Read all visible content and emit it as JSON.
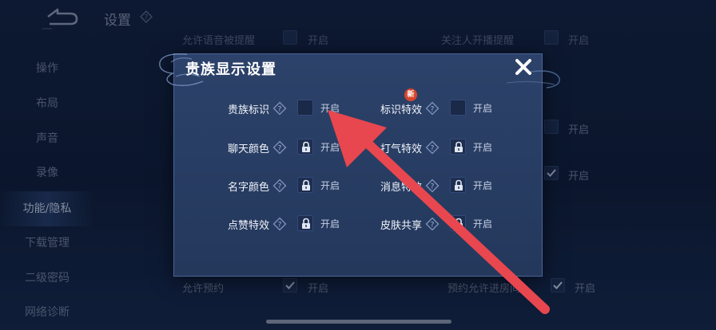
{
  "header": {
    "title": "设置",
    "back_icon": "back-arrow-icon",
    "help_icon": "help-diamond-icon"
  },
  "sidebar": {
    "items": [
      {
        "label": "操作"
      },
      {
        "label": "布局"
      },
      {
        "label": "声音"
      },
      {
        "label": "录像"
      },
      {
        "label": "功能/隐私",
        "active": true
      },
      {
        "label": "下载管理"
      },
      {
        "label": "二级密码"
      },
      {
        "label": "网络诊断"
      }
    ]
  },
  "background": {
    "top_left_label": "允许语音被提醒",
    "top_left_value": "开启",
    "top_right_label": "关注人开播提醒",
    "top_right_value": "开启",
    "mid_right_value_1": "开启",
    "mid_right_value_2": "开启",
    "bottom_left_label": "允许预约",
    "bottom_left_value": "开启",
    "bottom_right_label": "预约允许进房间",
    "bottom_right_value": "开启"
  },
  "dialog": {
    "title": "贵族显示设置",
    "close_icon": "close-x-icon",
    "new_badge": "新",
    "settings": [
      {
        "label": "贵族标识",
        "value": "开启",
        "locked": false,
        "checked": false
      },
      {
        "label": "标识特效",
        "value": "开启",
        "locked": false,
        "checked": false,
        "new": true
      },
      {
        "label": "聊天颜色",
        "value": "开启",
        "locked": true,
        "checked": false
      },
      {
        "label": "打气特效",
        "value": "开启",
        "locked": true,
        "checked": false
      },
      {
        "label": "名字颜色",
        "value": "开启",
        "locked": true,
        "checked": false
      },
      {
        "label": "消息特效",
        "value": "开启",
        "locked": true,
        "checked": false
      },
      {
        "label": "点赞特效",
        "value": "开启",
        "locked": true,
        "checked": false
      },
      {
        "label": "皮肤共享",
        "value": "开启",
        "locked": true,
        "checked": false
      }
    ]
  },
  "annotation": {
    "arrow_color": "#e8474f"
  },
  "colors": {
    "dialog_bg": "#2a3f66",
    "dialog_border": "#4b6496",
    "app_bg": "#11213f",
    "badge_red": "#d8452c"
  }
}
